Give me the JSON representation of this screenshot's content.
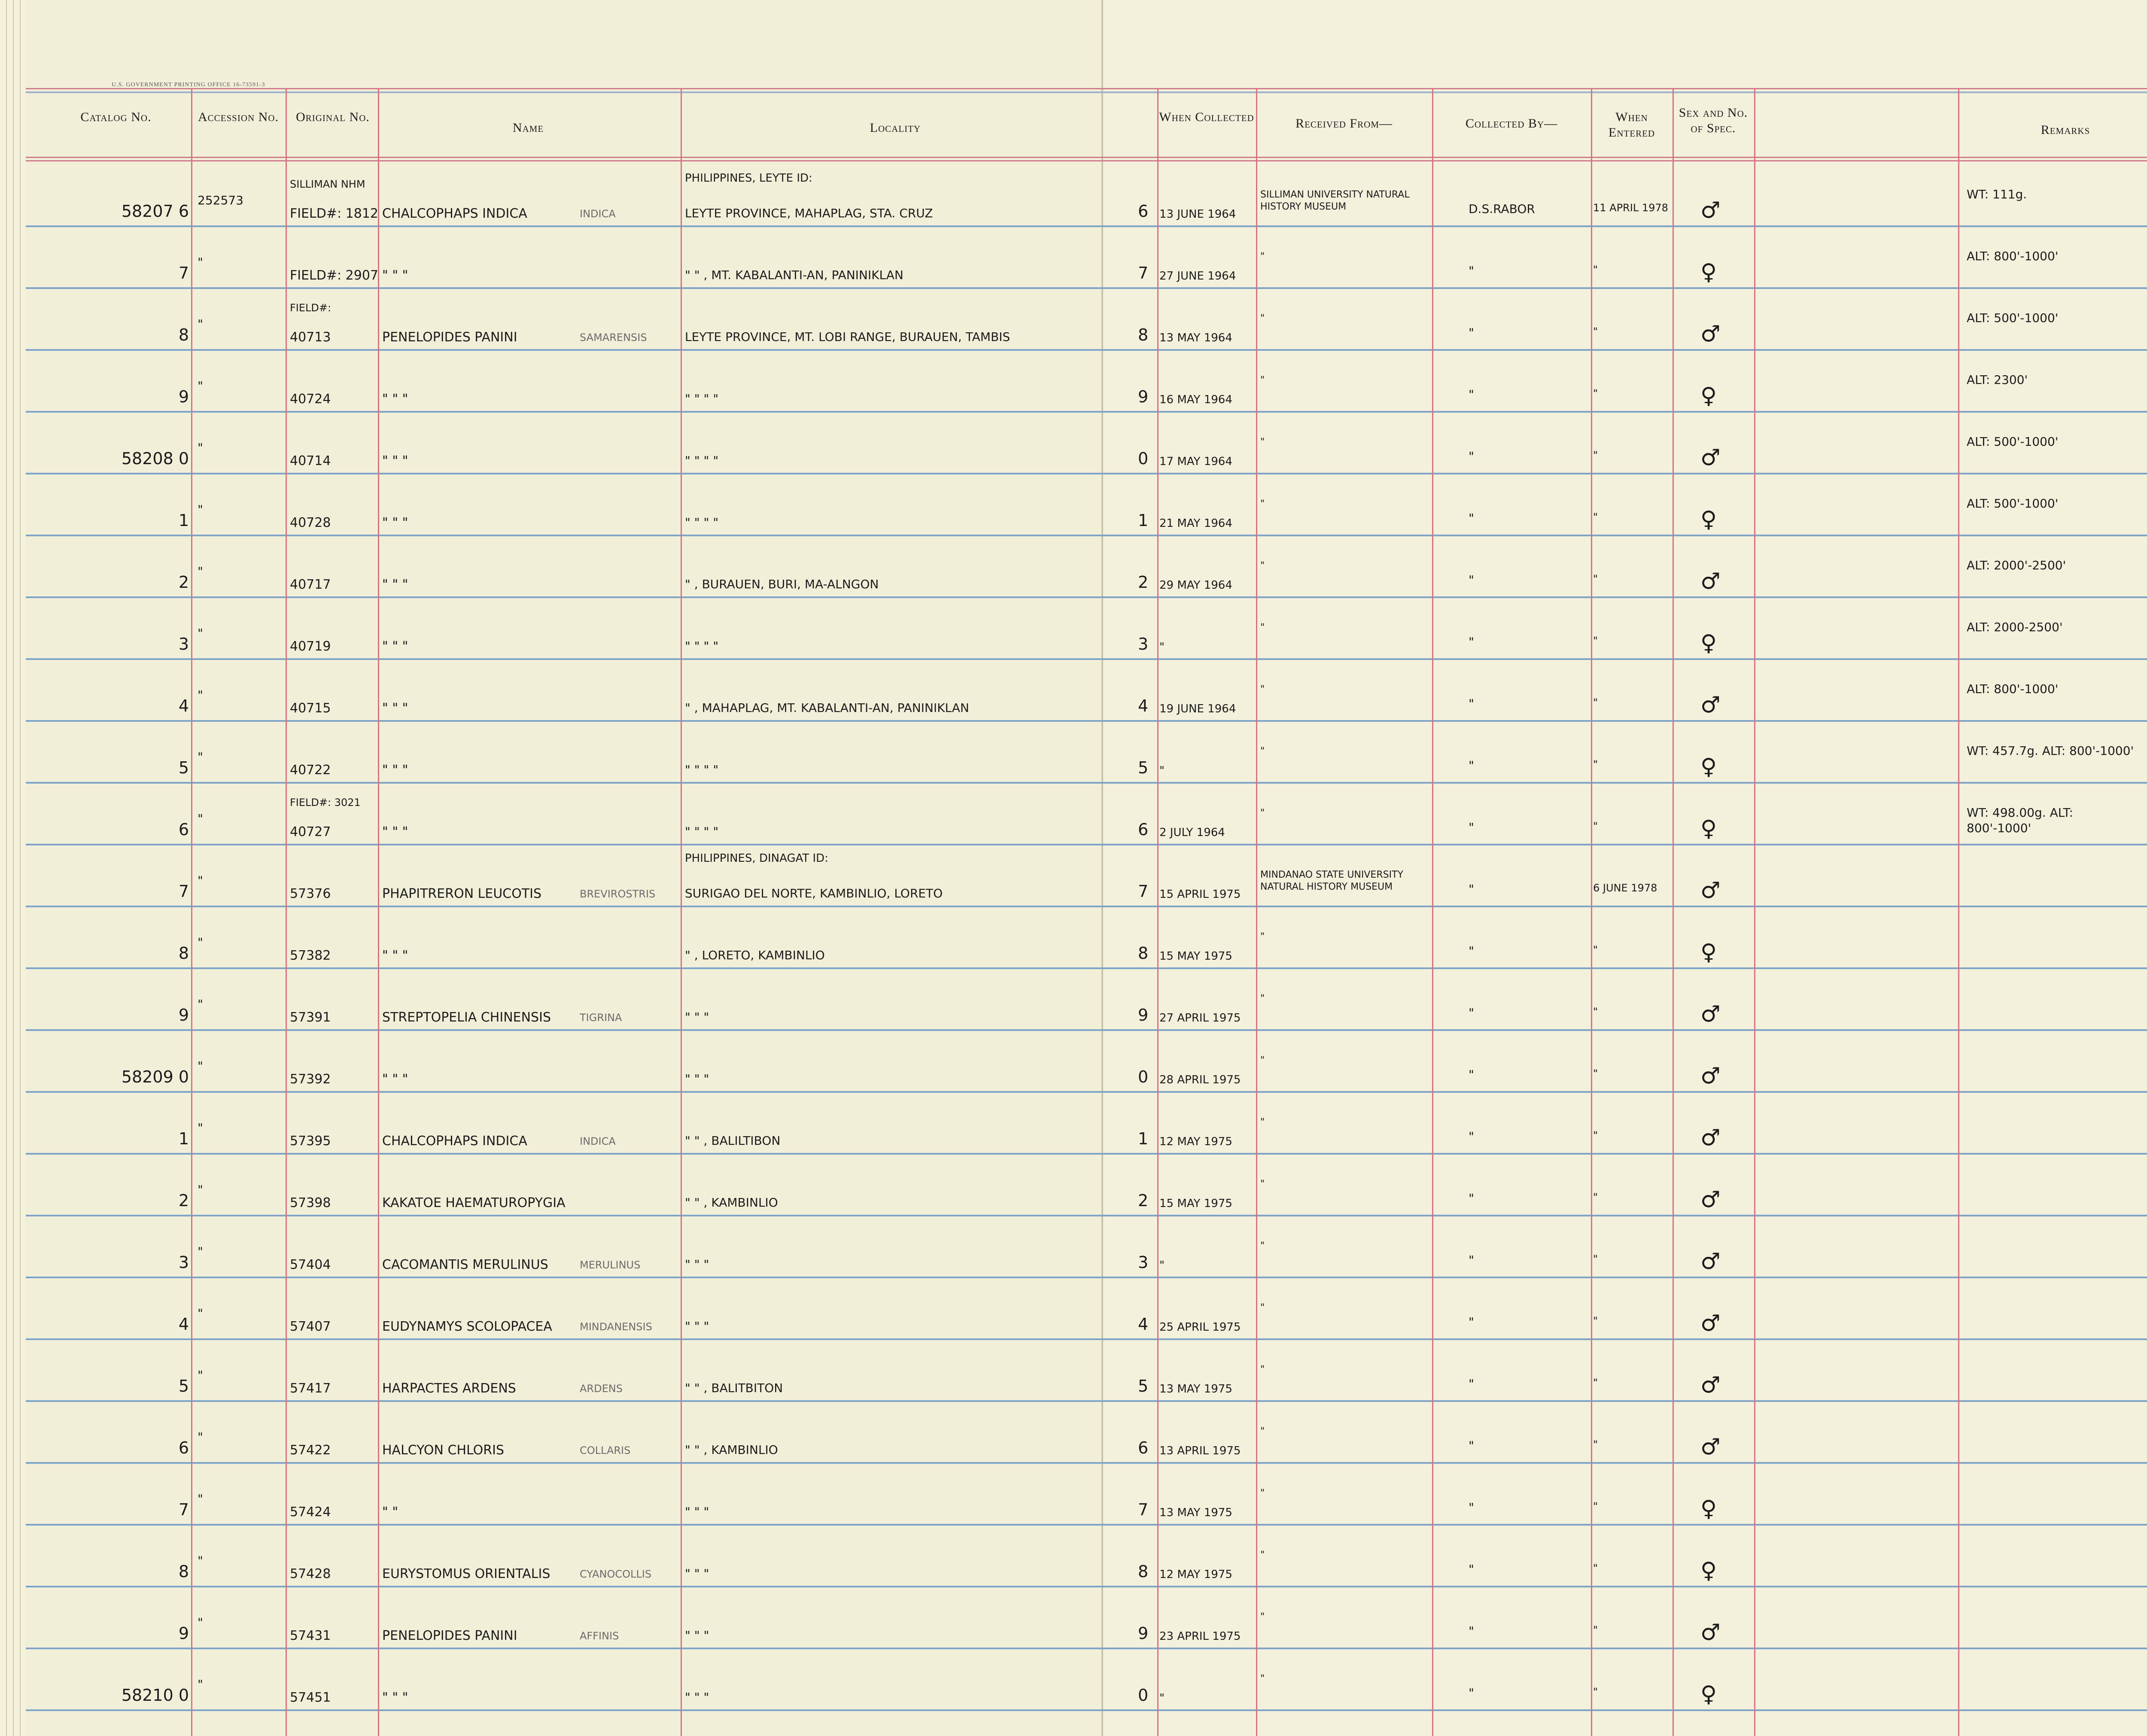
{
  "header": {
    "gpo": "U.S. GOVERNMENT PRINTING OFFICE 16-73591-3",
    "catalog": "Catalog No.",
    "accession": "Accession No.",
    "original": "Original No.",
    "name": "Name",
    "locality": "Locality",
    "when_collected": "When Collected",
    "received_from": "Received From—",
    "collected_by": "Collected By—",
    "when_entered": "When Entered",
    "sex": "Sex and No. of Spec.",
    "remarks": "Remarks"
  },
  "rows": [
    {
      "cat": "58207 6",
      "acc": "252573",
      "orig": "FIELD#: 1812",
      "orig2": "SILLIMAN NHM",
      "name": "CHALCOPHAPS INDICA",
      "sub": "INDICA",
      "loc_pre": "PHILIPPINES, LEYTE ID:",
      "loc": "LEYTE PROVINCE, MAHAPLAG, STA. CRUZ",
      "d": "6",
      "date": "13 JUNE 1964",
      "recv": "SILLIMAN UNIVERSITY NATURAL HISTORY MUSEUM",
      "coll": "D.S.RABOR",
      "ent": "11 APRIL 1978",
      "sex": "♂",
      "rem": "WT: 111g."
    },
    {
      "cat": "7",
      "acc": "\"",
      "orig": "FIELD#: 2907",
      "orig2": "",
      "name": "\"   \"   \"",
      "sub": "",
      "loc_pre": "",
      "loc": "\"   \"   , MT. KABALANTI-AN, PANINIKLAN",
      "d": "7",
      "date": "27 JUNE 1964",
      "recv": "\"",
      "coll": "\"",
      "ent": "\"",
      "sex": "♀",
      "rem": "ALT: 800'-1000'"
    },
    {
      "cat": "8",
      "acc": "\"",
      "orig": "40713",
      "orig2": "FIELD#:",
      "name": "PENELOPIDES PANINI",
      "sub": "SAMARENSIS",
      "loc_pre": "",
      "loc": "LEYTE PROVINCE, MT. LOBI RANGE, BURAUEN, TAMBIS",
      "d": "8",
      "date": "13 MAY 1964",
      "recv": "\"",
      "coll": "\"",
      "ent": "\"",
      "sex": "♂",
      "rem": "ALT: 500'-1000'"
    },
    {
      "cat": "9",
      "acc": "\"",
      "orig": "40724",
      "orig2": "",
      "name": "\"   \"   \"",
      "sub": "",
      "loc_pre": "",
      "loc": "\"   \"   \"   \"",
      "d": "9",
      "date": "16 MAY 1964",
      "recv": "\"",
      "coll": "\"",
      "ent": "\"",
      "sex": "♀",
      "rem": "ALT: 2300'"
    },
    {
      "cat": "58208 0",
      "acc": "\"",
      "orig": "40714",
      "orig2": "",
      "name": "\"   \"   \"",
      "sub": "",
      "loc_pre": "",
      "loc": "\"   \"   \"   \"",
      "d": "0",
      "date": "17 MAY 1964",
      "recv": "\"",
      "coll": "\"",
      "ent": "\"",
      "sex": "♂",
      "rem": "ALT: 500'-1000'"
    },
    {
      "cat": "1",
      "acc": "\"",
      "orig": "40728",
      "orig2": "",
      "name": "\"   \"   \"",
      "sub": "",
      "loc_pre": "",
      "loc": "\"   \"   \"   \"",
      "d": "1",
      "date": "21 MAY 1964",
      "recv": "\"",
      "coll": "\"",
      "ent": "\"",
      "sex": "♀",
      "rem": "ALT: 500'-1000'"
    },
    {
      "cat": "2",
      "acc": "\"",
      "orig": "40717",
      "orig2": "",
      "name": "\"   \"   \"",
      "sub": "",
      "loc_pre": "",
      "loc": "\"   , BURAUEN, BURI, MA-ALNGON",
      "d": "2",
      "date": "29 MAY 1964",
      "recv": "\"",
      "coll": "\"",
      "ent": "\"",
      "sex": "♂",
      "rem": "ALT: 2000'-2500'"
    },
    {
      "cat": "3",
      "acc": "\"",
      "orig": "40719",
      "orig2": "",
      "name": "\"   \"   \"",
      "sub": "",
      "loc_pre": "",
      "loc": "\"   \"   \"   \"",
      "d": "3",
      "date": "\"",
      "recv": "\"",
      "coll": "\"",
      "ent": "\"",
      "sex": "♀",
      "rem": "ALT: 2000-2500'"
    },
    {
      "cat": "4",
      "acc": "\"",
      "orig": "40715",
      "orig2": "",
      "name": "\"   \"   \"",
      "sub": "",
      "loc_pre": "",
      "loc": "\"   , MAHAPLAG, MT. KABALANTI-AN, PANINIKLAN",
      "d": "4",
      "date": "19 JUNE 1964",
      "recv": "\"",
      "coll": "\"",
      "ent": "\"",
      "sex": "♂",
      "rem": "ALT: 800'-1000'"
    },
    {
      "cat": "5",
      "acc": "\"",
      "orig": "40722",
      "orig2": "",
      "name": "\"   \"   \"",
      "sub": "",
      "loc_pre": "",
      "loc": "\"   \"   \"   \"",
      "d": "5",
      "date": "\"",
      "recv": "\"",
      "coll": "\"",
      "ent": "\"",
      "sex": "♀",
      "rem": "WT: 457.7g. ALT: 800'-1000'"
    },
    {
      "cat": "6",
      "acc": "\"",
      "orig": "40727",
      "orig2": "FIELD#: 3021",
      "name": "\"   \"   \"",
      "sub": "",
      "loc_pre": "",
      "loc": "\"   \"   \"   \"",
      "d": "6",
      "date": "2 JULY 1964",
      "recv": "\"",
      "coll": "\"",
      "ent": "\"",
      "sex": "♀",
      "rem": "WT: 498.00g. ALT: 800'-1000'"
    },
    {
      "cat": "7",
      "acc": "\"",
      "orig": "57376",
      "orig2": "",
      "name": "PHAPITRERON LEUCOTIS",
      "sub": "BREVIROSTRIS",
      "loc_pre": "PHILIPPINES, DINAGAT ID:",
      "loc": "SURIGAO DEL NORTE, KAMBINLIO, LORETO",
      "d": "7",
      "date": "15 APRIL 1975",
      "recv": "MINDANAO STATE UNIVERSITY NATURAL HISTORY MUSEUM",
      "coll": "\"",
      "ent": "6 JUNE 1978",
      "sex": "♂",
      "rem": ""
    },
    {
      "cat": "8",
      "acc": "\"",
      "orig": "57382",
      "orig2": "",
      "name": "\"   \"   \"",
      "sub": "",
      "loc_pre": "",
      "loc": "\"   , LORETO, KAMBINLIO",
      "d": "8",
      "date": "15 MAY 1975",
      "recv": "\"",
      "coll": "\"",
      "ent": "\"",
      "sex": "♀",
      "rem": ""
    },
    {
      "cat": "9",
      "acc": "\"",
      "orig": "57391",
      "orig2": "",
      "name": "STREPTOPELIA CHINENSIS",
      "sub": "TIGRINA",
      "loc_pre": "",
      "loc": "\"   \"   \"",
      "d": "9",
      "date": "27 APRIL 1975",
      "recv": "\"",
      "coll": "\"",
      "ent": "\"",
      "sex": "♂",
      "rem": ""
    },
    {
      "cat": "58209 0",
      "acc": "\"",
      "orig": "57392",
      "orig2": "",
      "name": "\"   \"   \"",
      "sub": "",
      "loc_pre": "",
      "loc": "\"   \"   \"",
      "d": "0",
      "date": "28 APRIL 1975",
      "recv": "\"",
      "coll": "\"",
      "ent": "\"",
      "sex": "♂",
      "rem": ""
    },
    {
      "cat": "1",
      "acc": "\"",
      "orig": "57395",
      "orig2": "",
      "name": "CHALCOPHAPS INDICA",
      "sub": "INDICA",
      "loc_pre": "",
      "loc": "\"   \"   , BALILTIBON",
      "d": "1",
      "date": "12 MAY 1975",
      "recv": "\"",
      "coll": "\"",
      "ent": "\"",
      "sex": "♂",
      "rem": ""
    },
    {
      "cat": "2",
      "acc": "\"",
      "orig": "57398",
      "orig2": "",
      "name": "KAKATOE HAEMATUROPYGIA",
      "sub": "",
      "loc_pre": "",
      "loc": "\"   \"   , KAMBINLIO",
      "d": "2",
      "date": "15 MAY 1975",
      "recv": "\"",
      "coll": "\"",
      "ent": "\"",
      "sex": "♂",
      "rem": ""
    },
    {
      "cat": "3",
      "acc": "\"",
      "orig": "57404",
      "orig2": "",
      "name": "CACOMANTIS MERULINUS",
      "sub": "MERULINUS",
      "loc_pre": "",
      "loc": "\"   \"   \"",
      "d": "3",
      "date": "\"",
      "recv": "\"",
      "coll": "\"",
      "ent": "\"",
      "sex": "♂",
      "rem": ""
    },
    {
      "cat": "4",
      "acc": "\"",
      "orig": "57407",
      "orig2": "",
      "name": "EUDYNAMYS SCOLOPACEA",
      "sub": "MINDANENSIS",
      "loc_pre": "",
      "loc": "\"   \"   \"",
      "d": "4",
      "date": "25 APRIL 1975",
      "recv": "\"",
      "coll": "\"",
      "ent": "\"",
      "sex": "♂",
      "rem": ""
    },
    {
      "cat": "5",
      "acc": "\"",
      "orig": "57417",
      "orig2": "",
      "name": "HARPACTES ARDENS",
      "sub": "ARDENS",
      "loc_pre": "",
      "loc": "\"   \"   , BALITBITON",
      "d": "5",
      "date": "13 MAY 1975",
      "recv": "\"",
      "coll": "\"",
      "ent": "\"",
      "sex": "♂",
      "rem": ""
    },
    {
      "cat": "6",
      "acc": "\"",
      "orig": "57422",
      "orig2": "",
      "name": "HALCYON CHLORIS",
      "sub": "COLLARIS",
      "loc_pre": "",
      "loc": "\"   \"   , KAMBINLIO",
      "d": "6",
      "date": "13 APRIL 1975",
      "recv": "\"",
      "coll": "\"",
      "ent": "\"",
      "sex": "♂",
      "rem": ""
    },
    {
      "cat": "7",
      "acc": "\"",
      "orig": "57424",
      "orig2": "",
      "name": "\"   \"",
      "sub": "",
      "loc_pre": "",
      "loc": "\"   \"   \"",
      "d": "7",
      "date": "13 MAY 1975",
      "recv": "\"",
      "coll": "\"",
      "ent": "\"",
      "sex": "♀",
      "rem": ""
    },
    {
      "cat": "8",
      "acc": "\"",
      "orig": "57428",
      "orig2": "",
      "name": "EURYSTOMUS ORIENTALIS",
      "sub": "CYANOCOLLIS",
      "loc_pre": "",
      "loc": "\"   \"   \"",
      "d": "8",
      "date": "12 MAY 1975",
      "recv": "\"",
      "coll": "\"",
      "ent": "\"",
      "sex": "♀",
      "rem": ""
    },
    {
      "cat": "9",
      "acc": "\"",
      "orig": "57431",
      "orig2": "",
      "name": "PENELOPIDES PANINI",
      "sub": "AFFINIS",
      "loc_pre": "",
      "loc": "\"   \"   \"",
      "d": "9",
      "date": "23 APRIL 1975",
      "recv": "\"",
      "coll": "\"",
      "ent": "\"",
      "sex": "♂",
      "rem": ""
    },
    {
      "cat": "58210 0",
      "acc": "\"",
      "orig": "57451",
      "orig2": "",
      "name": "\"   \"   \"",
      "sub": "",
      "loc_pre": "",
      "loc": "\"   \"   \"",
      "d": "0",
      "date": "\"",
      "recv": "\"",
      "coll": "\"",
      "ent": "\"",
      "sex": "♀",
      "rem": ""
    }
  ]
}
